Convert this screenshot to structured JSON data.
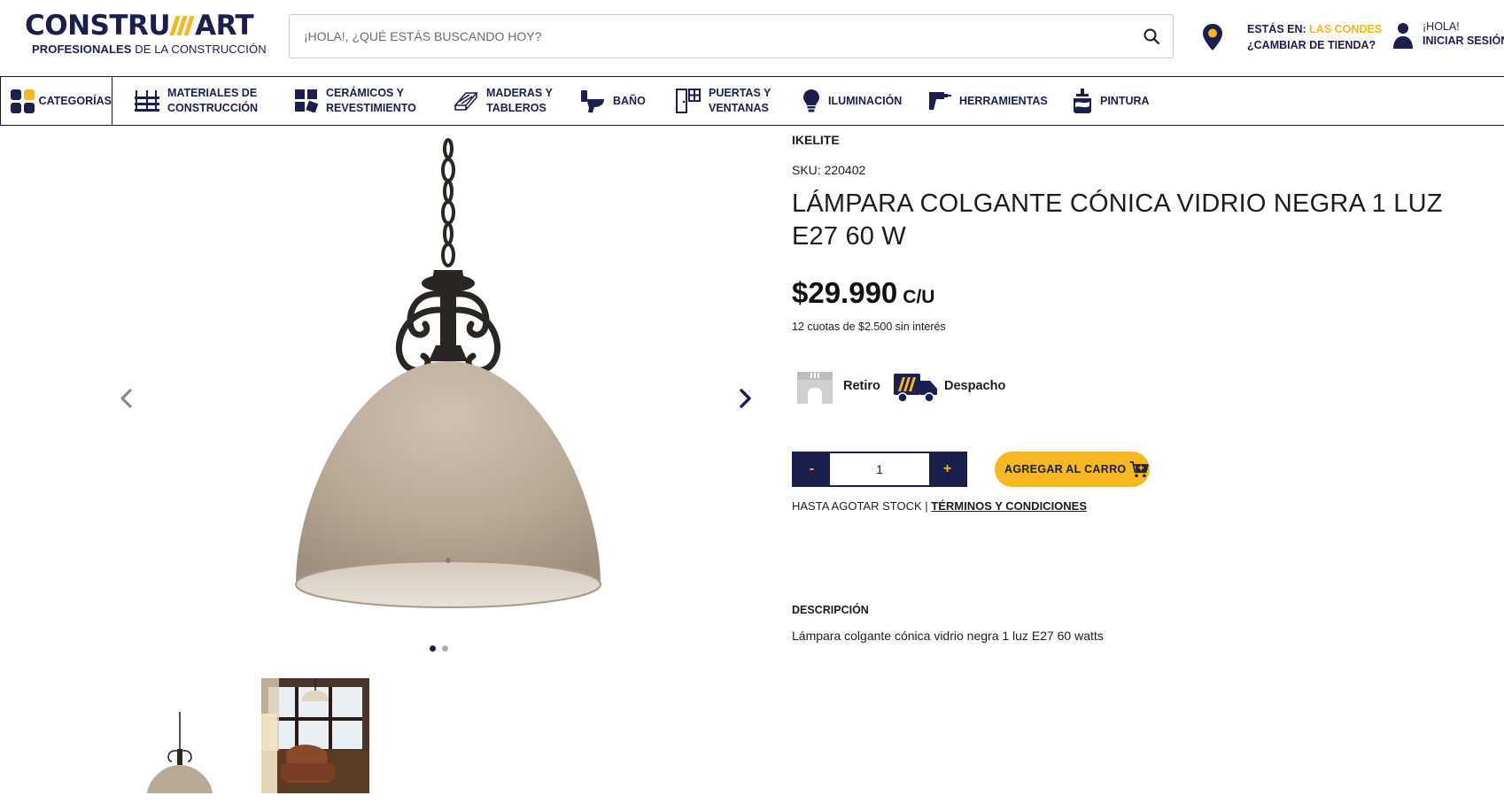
{
  "header": {
    "logo_left": "CONSTRU",
    "logo_right": "ART",
    "logo_tagline_bold": "PROFESIONALES",
    "logo_tagline_rest": " DE LA CONSTRUCCIÓN",
    "search_placeholder": "¡HOLA!, ¿QUÉ ESTÁS BUSCANDO HOY?",
    "store_prefix": "ESTÁS EN: ",
    "store_name": "LAS CONDES",
    "store_change": "¿CAMBIAR DE TIENDA?",
    "greeting": "¡HOLA!",
    "login_label": "INICIAR SESIÓN"
  },
  "nav": {
    "categories_label": "CATEGORÍAS",
    "items": [
      {
        "line1": "MATERIALES DE",
        "line2": "CONSTRUCCIÓN",
        "icon": "brick-icon"
      },
      {
        "line1": "CERÁMICOS Y",
        "line2": "REVESTIMIENTO",
        "icon": "tiles-icon"
      },
      {
        "line1": "MADERAS Y",
        "line2": "TABLEROS",
        "icon": "wood-icon"
      },
      {
        "line1": "BAÑO",
        "line2": "",
        "icon": "toilet-icon"
      },
      {
        "line1": "PUERTAS Y",
        "line2": "VENTANAS",
        "icon": "door-icon"
      },
      {
        "line1": "ILUMINACIÓN",
        "line2": "",
        "icon": "bulb-icon"
      },
      {
        "line1": "HERRAMIENTAS",
        "line2": "",
        "icon": "drill-icon"
      },
      {
        "line1": "PINTURA",
        "line2": "",
        "icon": "paint-icon"
      }
    ]
  },
  "product": {
    "brand": "IKELITE",
    "sku": "SKU: 220402",
    "title": "LÁMPARA COLGANTE CÓNICA VIDRIO NEGRA 1 LUZ E27 60 W",
    "price": "$29.990",
    "unit": "C/U",
    "installments": "12 cuotas de $2.500 sin interés",
    "retiro_label": "Retiro",
    "despacho_label": "Despacho",
    "quantity": "1",
    "minus_label": "-",
    "plus_label": "+",
    "add_to_cart_label": "AGREGAR AL CARRO",
    "stock_note": "HASTA AGOTAR STOCK | ",
    "terms_label": "TÉRMINOS Y CONDICIONES",
    "description_heading": "DESCRIPCIÓN",
    "description_text": "Lámpara colgante cónica vidrio negra 1 luz E27 60 watts"
  },
  "gallery": {
    "image_count": 2,
    "active_index": 0
  },
  "colors": {
    "brand_navy": "#1a1f4e",
    "brand_yellow": "#f6b722"
  }
}
